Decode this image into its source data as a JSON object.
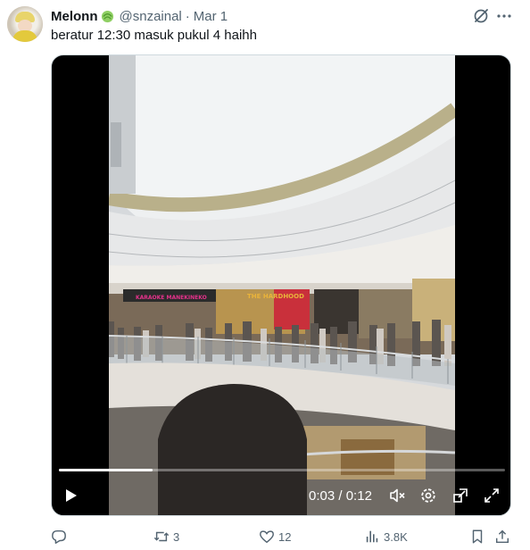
{
  "tweet": {
    "display_name": "Melonn",
    "name_emoji": "melon-icon",
    "handle": "@snzainal",
    "separator": "·",
    "date": "Mar 1",
    "text": "beratur 12:30 masuk pukul 4 haihh"
  },
  "video": {
    "current_time": "0:03",
    "time_separator": " / ",
    "duration": "0:12",
    "progress_fraction": 0.21,
    "controls": [
      "play-icon",
      "mute-icon",
      "settings-icon",
      "picture-in-picture-icon",
      "fullscreen-icon"
    ],
    "scene_signs": [
      "KARAOKE MANEKINEKO",
      "THE HARDHOOD"
    ]
  },
  "actions": {
    "replies": "",
    "retweets": "3",
    "likes": "12",
    "views": "3.8K"
  },
  "colors": {
    "text_primary": "#0f1419",
    "text_secondary": "#536471",
    "media_border": "#cfd9de",
    "sign_pink": "#e6328c",
    "sign_gold": "#e9b33a"
  }
}
